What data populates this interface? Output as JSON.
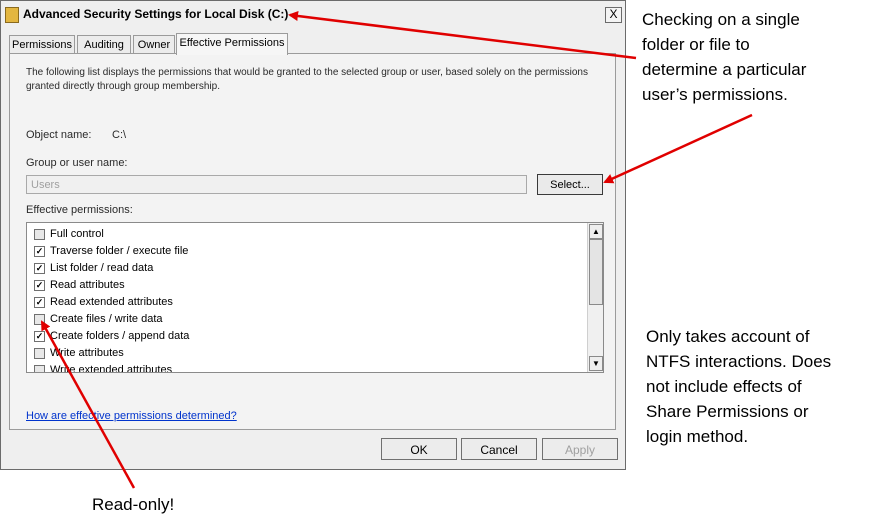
{
  "window": {
    "title": "Advanced Security Settings for Local Disk (C:)",
    "close_glyph": "X"
  },
  "tabs": [
    {
      "label": "Permissions"
    },
    {
      "label": "Auditing"
    },
    {
      "label": "Owner"
    },
    {
      "label": "Effective Permissions",
      "active": true
    }
  ],
  "panel": {
    "description": "The following list displays the permissions that would be granted to the selected group or user, based solely on the permissions granted directly through group membership.",
    "object_name_label": "Object name:",
    "object_name_value": "C:\\",
    "group_label": "Group or user name:",
    "group_value": "Users",
    "select_label": "Select...",
    "effective_label": "Effective permissions:",
    "permissions": [
      {
        "label": "Full control",
        "checked": false
      },
      {
        "label": "Traverse folder / execute file",
        "checked": true
      },
      {
        "label": "List folder / read data",
        "checked": true
      },
      {
        "label": "Read attributes",
        "checked": true
      },
      {
        "label": "Read extended attributes",
        "checked": true
      },
      {
        "label": "Create files / write data",
        "checked": false
      },
      {
        "label": "Create folders / append data",
        "checked": true
      },
      {
        "label": "Write attributes",
        "checked": false
      },
      {
        "label": "Write extended attributes",
        "checked": false
      }
    ],
    "help_link": "How are effective permissions determined?"
  },
  "buttons": {
    "ok": "OK",
    "cancel": "Cancel",
    "apply": "Apply"
  },
  "annotations": {
    "top_right": [
      "Checking on a single",
      "folder or file to",
      "determine a particular",
      "user’s permissions."
    ],
    "bottom_right": [
      "Only takes account of",
      "NTFS interactions. Does",
      "not include effects of",
      "Share Permissions or",
      "login method."
    ],
    "bottom": "Read-only!"
  },
  "colors": {
    "arrow": "#e00000",
    "link": "#0033cc"
  }
}
